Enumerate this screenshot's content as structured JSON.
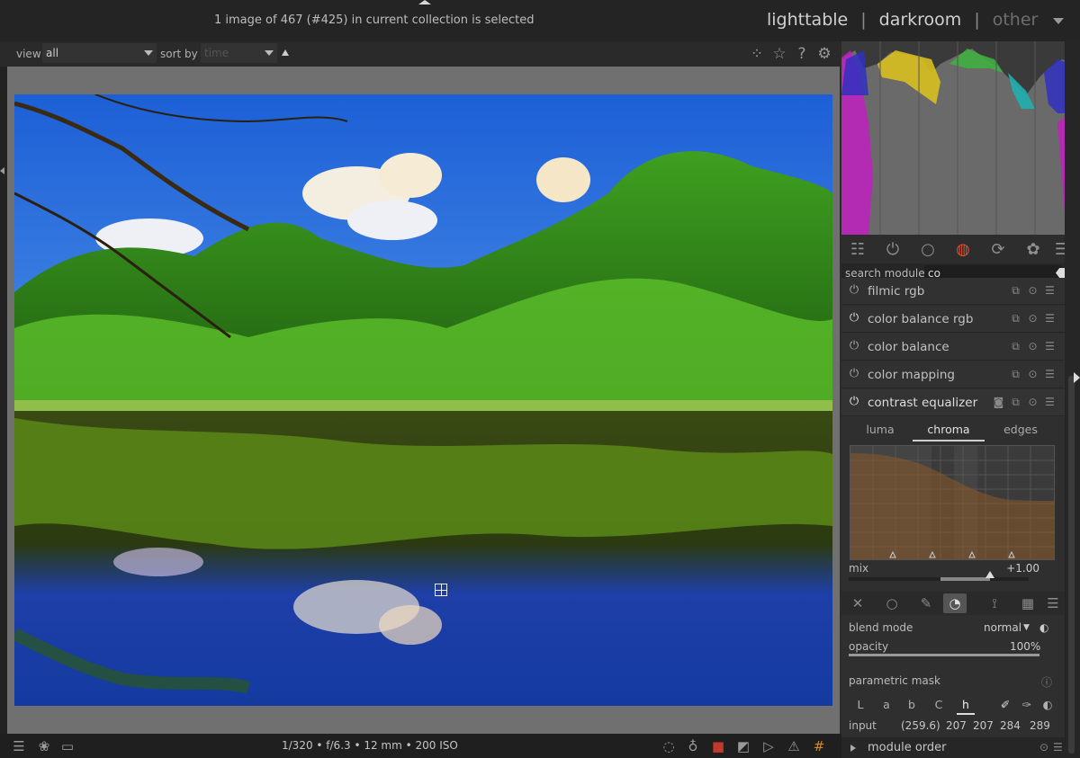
{
  "topbar": {
    "status": "1 image of 467 (#425) in current collection is selected",
    "views": {
      "lighttable": "lighttable",
      "darkroom": "darkroom",
      "other": "other",
      "separator": "|"
    }
  },
  "filterbar": {
    "view_label": "view",
    "view_value": "all",
    "sort_label": "sort by",
    "sort_value": "time"
  },
  "bottombar": {
    "info": "1/320 • f/6.3 • 12 mm • 200 ISO"
  },
  "panel": {
    "search_label": "search module",
    "search_value": "co",
    "modules": [
      {
        "label": "filmic rgb"
      },
      {
        "label": "color balance rgb"
      },
      {
        "label": "color balance"
      },
      {
        "label": "color mapping"
      },
      {
        "label": "contrast equalizer"
      }
    ],
    "ce_tabs": [
      "luma",
      "chroma",
      "edges"
    ],
    "mix_label": "mix",
    "mix_value": "+1.00",
    "blend_mode_label": "blend mode",
    "blend_mode_value": "normal",
    "opacity_label": "opacity",
    "opacity_value": "100%",
    "parametric_mask_label": "parametric mask",
    "channels": [
      "L",
      "a",
      "b",
      "C",
      "h"
    ],
    "input_label": "input",
    "input_values": [
      "(259.6)",
      "207",
      "207",
      "284",
      "289"
    ],
    "module_order_label": "module order"
  },
  "colors": {
    "bg": "#2b2b2b",
    "panel": "#2f2f2f",
    "histogram_bg": "#3a3a3a",
    "image_border": "#707070"
  }
}
